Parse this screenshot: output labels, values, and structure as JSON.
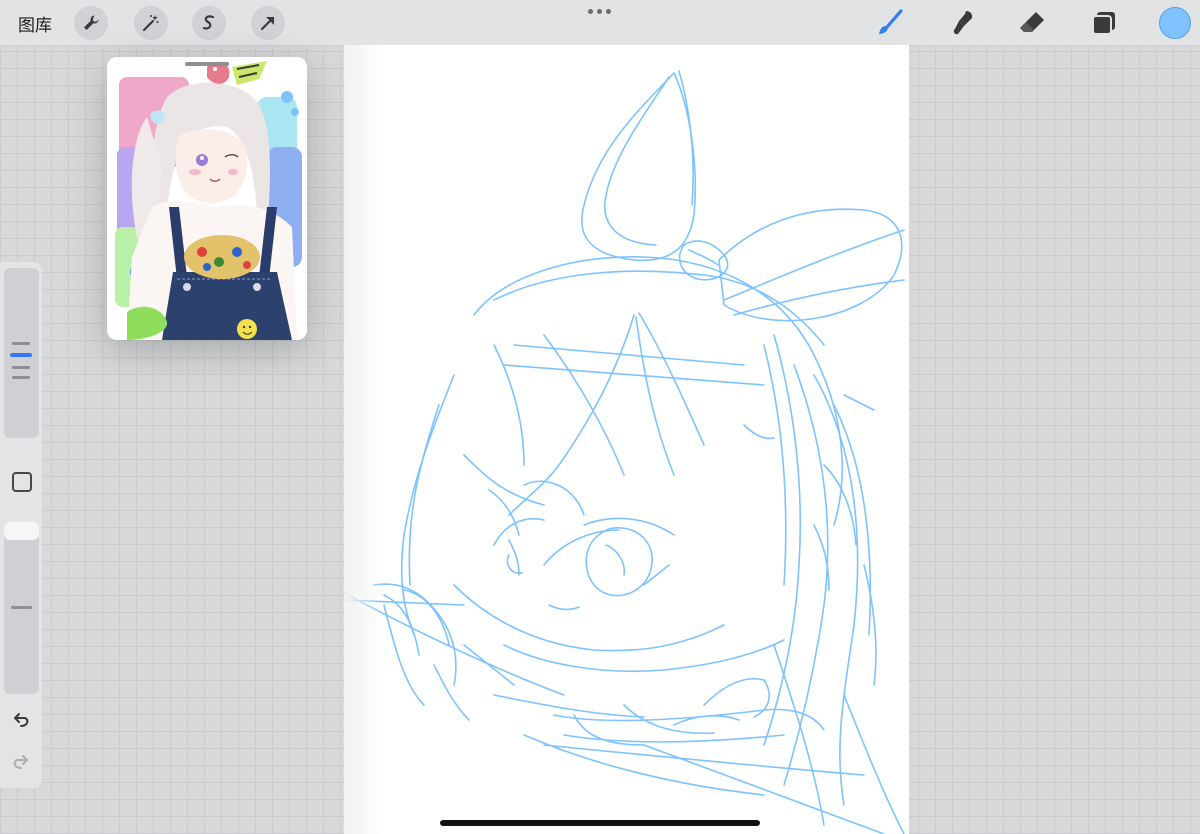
{
  "topbar": {
    "gallery_label": "图库",
    "left_tools": [
      "wrench-icon",
      "magic-wand-icon",
      "selection-icon",
      "transform-arrow-icon"
    ],
    "right_tools": [
      "brush-icon",
      "smudge-icon",
      "eraser-icon",
      "layers-icon"
    ],
    "current_color": "#7ec3ff"
  },
  "canvas": {
    "sketch_color": "#7ec3ff",
    "background": "#ffffff"
  },
  "sidebar": {
    "controls": [
      "brush-size-slider",
      "modify-button",
      "opacity-slider",
      "undo-icon",
      "redo-icon"
    ],
    "accent": "#3478f6"
  }
}
